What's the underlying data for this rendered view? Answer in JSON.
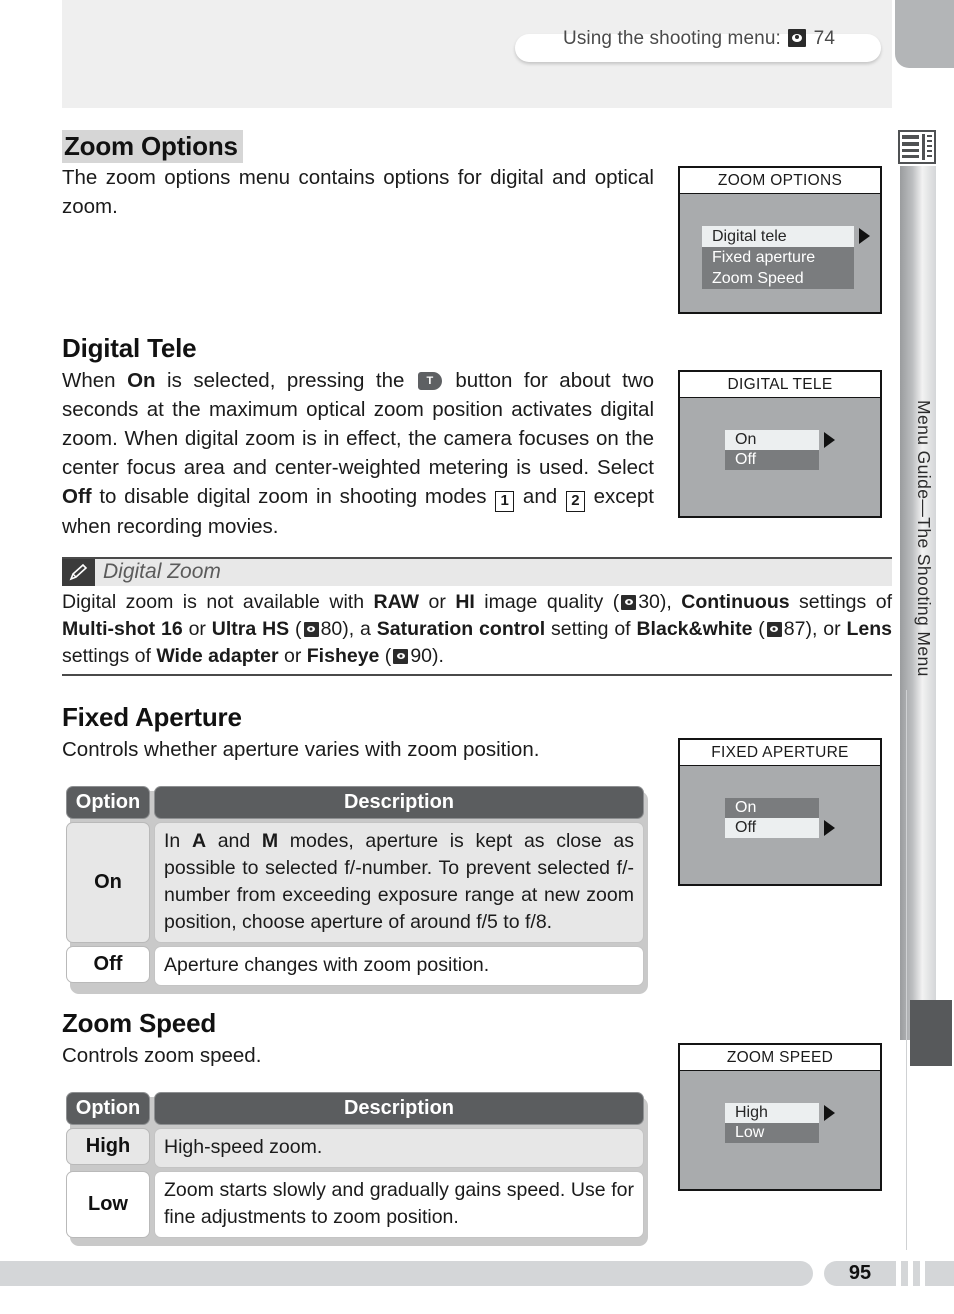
{
  "running_head": {
    "text_before": "Using the shooting menu:",
    "icon": "page-ref-icon",
    "page": "74"
  },
  "sections": {
    "zoom_options": {
      "heading": "Zoom Options",
      "body": "The zoom options menu contains options for digital and optical zoom."
    },
    "digital_tele": {
      "heading": "Digital Tele",
      "p1_a": "When ",
      "p1_b": "On",
      "p1_c": " is selected, pressing the ",
      "button_glyph": "T",
      "p1_d": " button for about two seconds at the maximum optical zoom position activates digital zoom.  When digital zoom is in effect, the camera focuses on the center focus area and center-weighted metering is used.  Select ",
      "p1_e": "Off",
      "p1_f": " to disable digital zoom in shooting modes ",
      "mode1": "1",
      "p1_g": " and ",
      "mode2": "2",
      "p1_h": " except when recording movies."
    },
    "digital_zoom_note": {
      "icon": "pencil-icon",
      "title": "Digital Zoom",
      "t1": "Digital zoom is not available with ",
      "raw": "RAW",
      "t2": " or ",
      "hi": "HI",
      "t3": " image quality (",
      "p30": "30), ",
      "continuous": "Continuous",
      "t4": " settings of ",
      "multishot": "Multi-shot 16",
      "t5": " or ",
      "ultrahs": "Ultra HS",
      "t6": " (",
      "p80": "80), a ",
      "saturation": "Saturation control",
      "t7": " setting of ",
      "blackwhite": "Black&white",
      "t8": " (",
      "p87": "87), or ",
      "lens": "Lens",
      "t9": " settings of ",
      "wideadapter": "Wide adapter",
      "t10": " or ",
      "fisheye": "Fisheye",
      "t11": " (",
      "p90": "90)."
    },
    "fixed_aperture": {
      "heading": "Fixed Aperture",
      "body": "Controls whether aperture varies with zoom position.",
      "table": {
        "headers": [
          "Option",
          "Description"
        ],
        "rows": [
          {
            "option": "On",
            "desc_a": "In ",
            "desc_A": "A",
            "desc_b": " and ",
            "desc_M": "M",
            "desc_c": " modes, aperture is kept as close as possible to selected f/-number.   To prevent selected f/-number from exceeding exposure range at new zoom position, choose aperture of around f/5 to f/8."
          },
          {
            "option": "Off",
            "desc": "Aperture changes with zoom position."
          }
        ]
      }
    },
    "zoom_speed": {
      "heading": "Zoom Speed",
      "body": "Controls zoom speed.",
      "table": {
        "headers": [
          "Option",
          "Description"
        ],
        "rows": [
          {
            "option": "High",
            "desc": "High-speed zoom."
          },
          {
            "option": "Low",
            "desc": "Zoom starts slowly and gradually gains speed. Use for fine adjustments to zoom position."
          }
        ]
      }
    }
  },
  "lcd_screens": [
    {
      "title": "ZOOM OPTIONS",
      "items": [
        {
          "label": "Digital tele",
          "selected": true,
          "arrow": true
        },
        {
          "label": "Fixed aperture",
          "selected": false,
          "arrow": false
        },
        {
          "label": "Zoom Speed",
          "selected": false,
          "arrow": false
        }
      ]
    },
    {
      "title": "DIGITAL TELE",
      "items": [
        {
          "label": "On",
          "selected": true,
          "arrow": true
        },
        {
          "label": "Off",
          "selected": false,
          "arrow": false
        }
      ]
    },
    {
      "title": "FIXED APERTURE",
      "items": [
        {
          "label": "On",
          "selected": false,
          "arrow": false
        },
        {
          "label": "Off",
          "selected": true,
          "arrow": true
        }
      ]
    },
    {
      "title": "ZOOM SPEED",
      "items": [
        {
          "label": "High",
          "selected": true,
          "arrow": true
        },
        {
          "label": "Low",
          "selected": false,
          "arrow": false
        }
      ]
    }
  ],
  "sidebar": {
    "icon": "menu-list-icon",
    "label": "Menu Guide—The Shooting Menu"
  },
  "footer": {
    "page_number": "95"
  },
  "colors": {
    "lcd_background": "#a9abad",
    "lcd_item_unselected": "#7a7c7e",
    "lcd_item_selected": "#eceff0",
    "table_header": "#5b5d5f",
    "heading_highlight": "#d6d6d6",
    "note_rule": "#4a4a4a"
  }
}
